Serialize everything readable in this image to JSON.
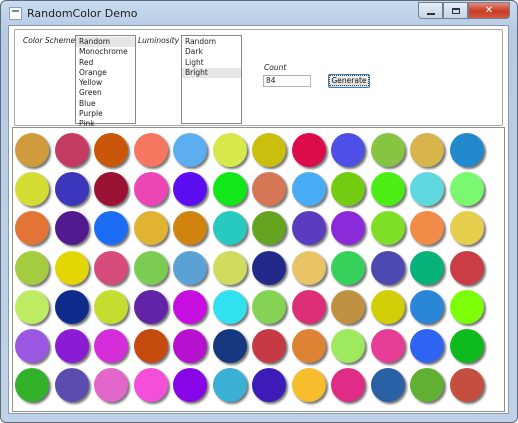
{
  "window": {
    "title": "RandomColor Demo"
  },
  "labels": {
    "color_scheme": "Color Scheme",
    "luminosity": "Luminosity",
    "count": "Count"
  },
  "color_scheme": {
    "items": [
      "Random",
      "Monochrome",
      "Red",
      "Orange",
      "Yellow",
      "Green",
      "Blue",
      "Purple",
      "Pink"
    ],
    "selected": "Random"
  },
  "luminosity": {
    "items": [
      "Random",
      "Dark",
      "Light",
      "Bright"
    ],
    "selected": "Bright"
  },
  "count": {
    "value": "84"
  },
  "generate_button": {
    "label": "Generate"
  },
  "circles": [
    "#cf9b3c",
    "#c43a60",
    "#ca5709",
    "#f6765f",
    "#5caef0",
    "#d6e84a",
    "#c9bf0c",
    "#dc0b4a",
    "#4d4fe6",
    "#86c441",
    "#d8b44c",
    "#2289cd",
    "#d4dd31",
    "#3b36bc",
    "#9c1234",
    "#ec45b6",
    "#5d0df1",
    "#12e71a",
    "#d57654",
    "#49adf5",
    "#74cc12",
    "#4cee15",
    "#5fd9e0",
    "#79f870",
    "#e27436",
    "#53198f",
    "#1c6cf4",
    "#e0b432",
    "#d1830f",
    "#27c9c0",
    "#65a320",
    "#5a3cbf",
    "#8b2ad8",
    "#7fdf26",
    "#f28b48",
    "#e6cf4d",
    "#a5cb41",
    "#e2d705",
    "#d74b7c",
    "#7ccc53",
    "#5ca1d5",
    "#cfdc5e",
    "#232989",
    "#e8c467",
    "#36d15a",
    "#4c4ab0",
    "#07b17a",
    "#cb3d45",
    "#bdec63",
    "#0f2c8c",
    "#c5dc30",
    "#6323a8",
    "#c60ede",
    "#32e1f0",
    "#84d354",
    "#dc2d76",
    "#c09141",
    "#d3cf07",
    "#2a86d6",
    "#7dfd07",
    "#9a58e2",
    "#8a1cd3",
    "#d52ed8",
    "#c54a0e",
    "#b611ce",
    "#15387f",
    "#c53a44",
    "#de8233",
    "#9fe95e",
    "#e63d96",
    "#2f64f2",
    "#0dbb1f",
    "#34b12a",
    "#5b4db0",
    "#e366cb",
    "#f44fd8",
    "#8705e6",
    "#3bb0d4",
    "#3c1bb8",
    "#f6bd2d",
    "#e02c86",
    "#2a60a6",
    "#61b033",
    "#c44f41"
  ]
}
